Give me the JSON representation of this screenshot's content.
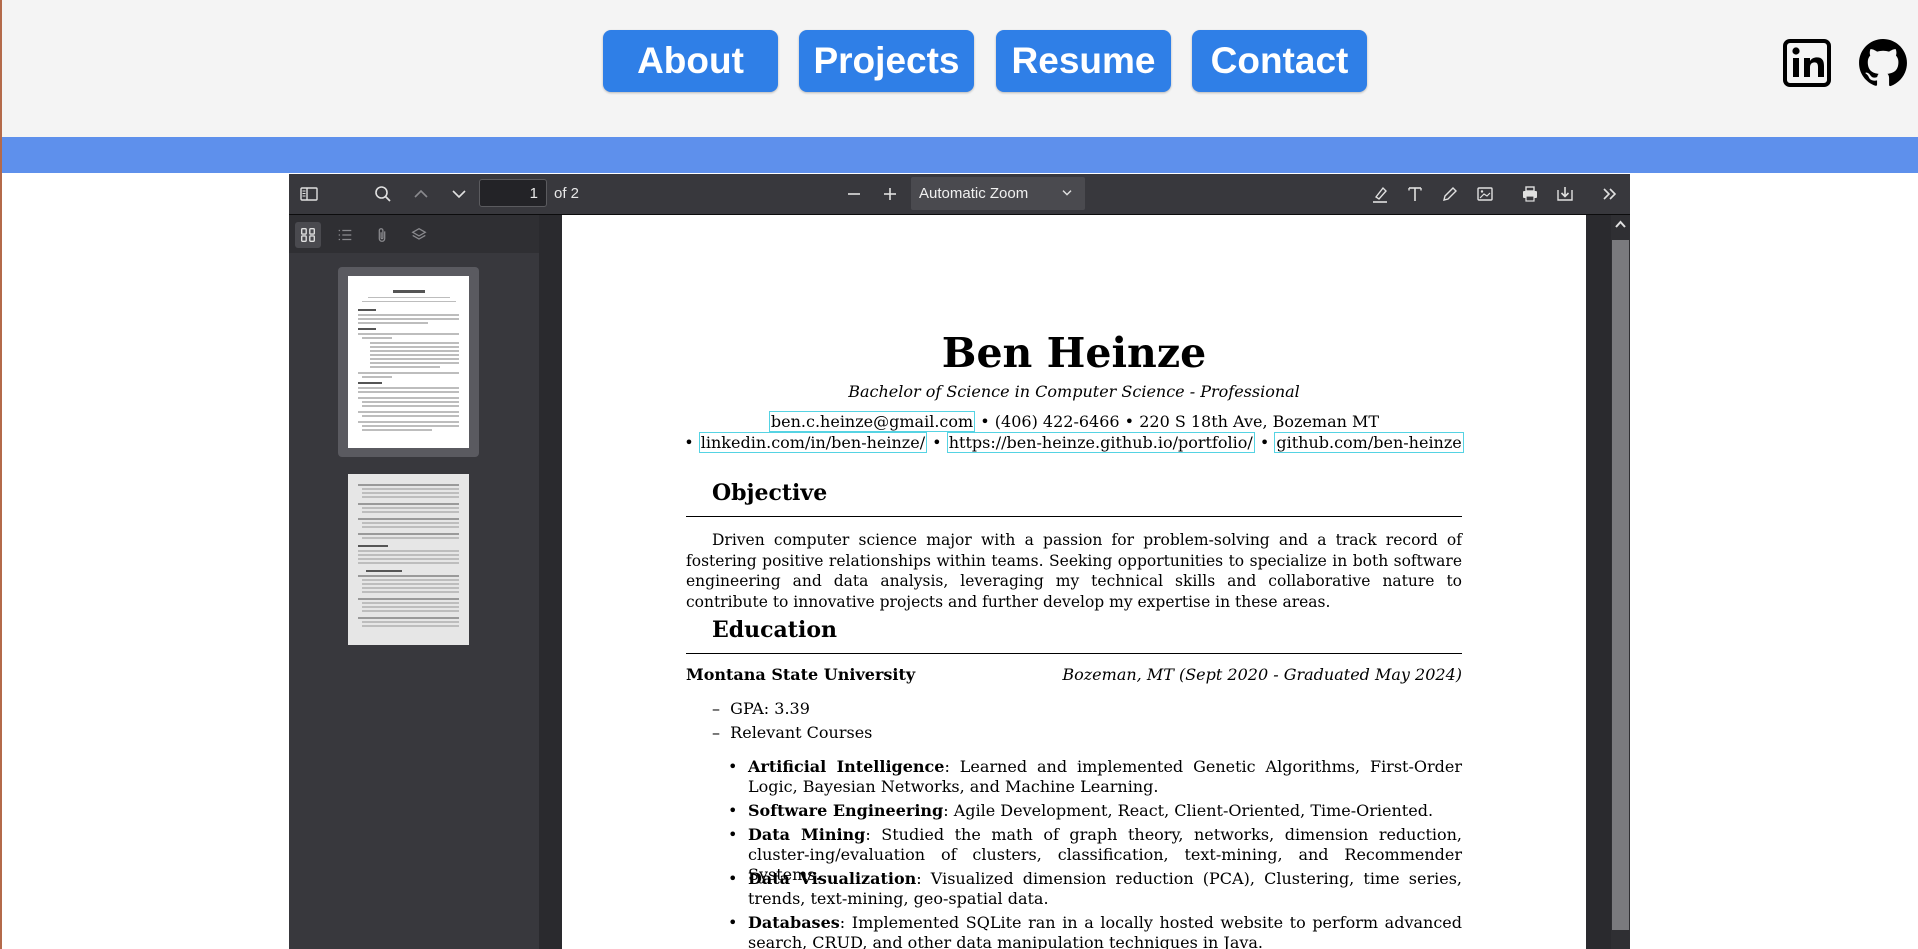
{
  "nav": {
    "buttons": [
      "About",
      "Projects",
      "Resume",
      "Contact"
    ],
    "accent": "#2f7fe7",
    "band": "#5e90ec",
    "social": [
      "linkedin-icon",
      "github-icon"
    ]
  },
  "viewer": {
    "page_number": "1",
    "page_count": "of 2",
    "zoom": "Automatic Zoom"
  },
  "resume": {
    "name": "Ben Heinze",
    "subtitle": "Bachelor of Science in Computer Science - Professional",
    "email": "ben.c.heinze@gmail.com",
    "phone": "(406) 422-6466",
    "address": "220 S 18th Ave, Bozeman MT",
    "linkedin": "linkedin.com/in/ben-heinze/",
    "portfolio": "https://ben-heinze.github.io/portfolio/",
    "github": "github.com/ben-heinze",
    "bullet": "•",
    "dash": "–",
    "objective_title": "Objective",
    "objective_text": "Driven computer science major with a passion for problem-solving and a track record of fostering positive relationships within teams. Seeking opportunities to specialize in both software engineering and data analysis, leveraging my technical skills and collaborative nature to contribute to innovative projects and further develop my expertise in these areas.",
    "education_title": "Education",
    "school": "Montana State University",
    "school_location": "Bozeman, MT (Sept 2020 - Graduated May 2024)",
    "gpa": "GPA: 3.39",
    "courses_label": "Relevant Courses",
    "courses": [
      {
        "name": "Artificial Intelligence",
        "desc": ": Learned and implemented Genetic Algorithms, First-Order Logic, Bayesian Networks, and Machine Learning."
      },
      {
        "name": "Software Engineering",
        "desc": ": Agile Development, React, Client-Oriented, Time-Oriented."
      },
      {
        "name": "Data Mining",
        "desc": ": Studied the math of graph theory, networks, dimension reduction, cluster-ing/evaluation of clusters, classification, text-mining, and Recommender Systems."
      },
      {
        "name": "Data Visualization",
        "desc": ": Visualized dimension reduction (PCA), Clustering, time series, trends, text-mining, geo-spatial data."
      },
      {
        "name": "Databases",
        "desc": ": Implemented SQLite ran in a locally hosted website to perform advanced search, CRUD, and other data manipulation techniques in Java."
      }
    ]
  }
}
